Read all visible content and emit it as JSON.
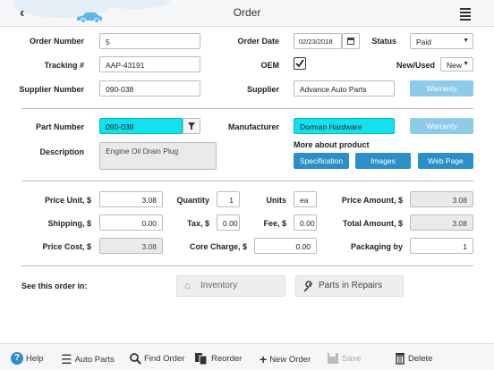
{
  "header": {
    "title": "Order"
  },
  "order": {
    "order_number_label": "Order Number",
    "order_number": "5",
    "order_date_label": "Order Date",
    "order_date": "02/23/2018",
    "status_label": "Status",
    "status": "Paid",
    "tracking_label": "Tracking #",
    "tracking": "AAP-43191",
    "oem_label": "OEM",
    "new_used_label": "New/Used",
    "new_used": "New",
    "supplier_number_label": "Supplier Number",
    "supplier_number": "090-038",
    "supplier_label": "Supplier",
    "supplier": "Advance Auto Parts",
    "warranty_label": "Warranty"
  },
  "part": {
    "part_number_label": "Part Number",
    "part_number": "090-038",
    "manufacturer_label": "Manufacturer",
    "manufacturer": "Dorman Hardware",
    "warranty_label": "Warranty",
    "description_label": "Description",
    "description": "Engine Oil Drain Plug",
    "more_about_label": "More about product",
    "specification_label": "Specification",
    "images_label": "Images",
    "webpage_label": "Web Page"
  },
  "pricing": {
    "price_unit_label": "Price Unit, $",
    "price_unit": "3.08",
    "quantity_label": "Quantity",
    "quantity": "1",
    "units_label": "Units",
    "units": "ea",
    "price_amount_label": "Price Amount, $",
    "price_amount": "3.08",
    "shipping_label": "Shipping, $",
    "shipping": "0.00",
    "tax_label": "Tax, $",
    "tax": "0.00",
    "fee_label": "Fee, $",
    "fee": "0.00",
    "total_amount_label": "Total Amount, $",
    "total_amount": "3.08",
    "price_cost_label": "Price Cost, $",
    "price_cost": "3.08",
    "core_charge_label": "Core Charge, $",
    "core_charge": "0.00",
    "packaging_label": "Packaging by",
    "packaging": "1"
  },
  "see_order": {
    "label": "See this order in:",
    "inventory": "Inventory",
    "parts_in_repairs": "Parts in Repairs"
  },
  "toolbar": {
    "help": "Help",
    "auto_parts": "Auto Parts",
    "find_order": "Find Order",
    "reorder": "Reorder",
    "new_order": "New Order",
    "save": "Save",
    "delete": "Delete"
  },
  "colors": {
    "accent": "#2d8fc8",
    "accent_light": "#8dcbe8",
    "highlight": "#15e0ee"
  }
}
